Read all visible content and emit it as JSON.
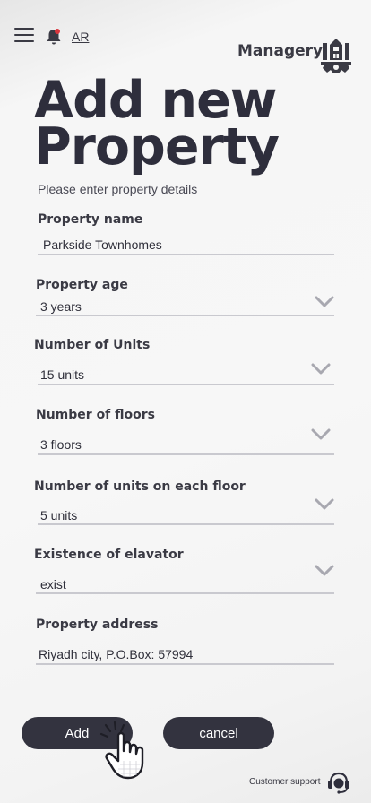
{
  "header": {
    "lang_label": "AR",
    "brand_name": "Managery"
  },
  "page": {
    "title_line1": "Add new",
    "title_line2": "Property",
    "subtitle": "Please enter property details"
  },
  "fields": [
    {
      "label": "Property name",
      "value": "Parkside Townhomes",
      "type": "text"
    },
    {
      "label": "Property age",
      "value": "3 years",
      "type": "select"
    },
    {
      "label": "Number of Units",
      "value": "15 units",
      "type": "select"
    },
    {
      "label": "Number of floors",
      "value": "3 floors",
      "type": "select"
    },
    {
      "label": "Number of units on each floor",
      "value": "5 units",
      "type": "select"
    },
    {
      "label": "Existence of elavator",
      "value": "exist",
      "type": "select"
    },
    {
      "label": "Property address",
      "value": "Riyadh city, P.O.Box: 57994",
      "type": "text"
    }
  ],
  "actions": {
    "add_label": "Add",
    "cancel_label": "cancel"
  },
  "footer": {
    "support_label": "Customer support"
  },
  "icons": {
    "menu": "hamburger-menu-icon",
    "notifications": "bell-icon",
    "logo": "managery-logo-icon",
    "dropdown": "chevron-down-icon",
    "pointer": "hand-pointer-icon",
    "support": "headset-icon"
  },
  "colors": {
    "primary_dark": "#33333f",
    "text": "#2e2e3c",
    "underline": "#c9c9cf",
    "notification_dot": "#d9363e"
  }
}
